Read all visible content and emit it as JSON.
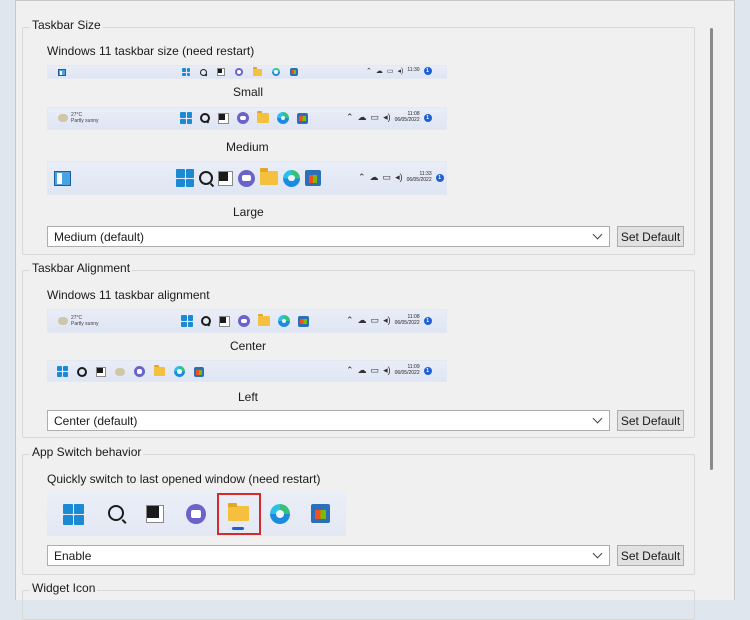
{
  "taskbar_size": {
    "group_title": "Taskbar Size",
    "label": "Windows 11 taskbar size (need restart)",
    "previews": [
      {
        "caption": "Small",
        "time": "11:30",
        "date": "",
        "badge": "1"
      },
      {
        "caption": "Medium",
        "time": "11:08",
        "date": "06/05/2022",
        "badge": "1",
        "weather_temp": "27°C",
        "weather_desc": "Partly sunny"
      },
      {
        "caption": "Large",
        "time": "11:33",
        "date": "06/05/2022",
        "badge": "1"
      }
    ],
    "dropdown_value": "Medium (default)",
    "set_default": "Set Default"
  },
  "taskbar_alignment": {
    "group_title": "Taskbar Alignment",
    "label": "Windows 11 taskbar alignment",
    "previews": [
      {
        "caption": "Center",
        "time": "11:08",
        "date": "06/05/2022",
        "badge": "1",
        "weather_temp": "27°C",
        "weather_desc": "Partly sunny"
      },
      {
        "caption": "Left",
        "time": "11:09",
        "date": "06/05/2022",
        "badge": "1"
      }
    ],
    "dropdown_value": "Center (default)",
    "set_default": "Set Default"
  },
  "app_switch": {
    "group_title": "App Switch behavior",
    "label": "Quickly switch to last opened window  (need restart)",
    "dropdown_value": "Enable",
    "set_default": "Set Default",
    "highlighted_icon": "file-explorer-icon"
  },
  "widget_icon": {
    "group_title": "Widget Icon"
  },
  "colors": {
    "highlight": "#d32a2a",
    "taskbar_bg": "#e4e9f4",
    "accent": "#1f5fd6"
  }
}
